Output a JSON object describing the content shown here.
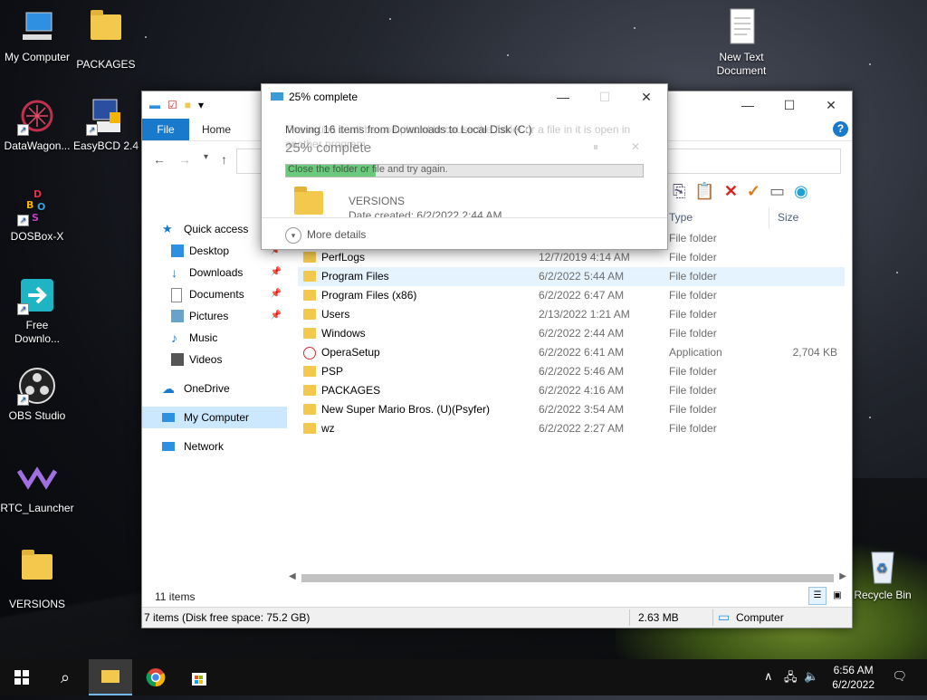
{
  "desktop": {
    "icons": [
      {
        "label": "My Computer"
      },
      {
        "label": "PACKAGES"
      },
      {
        "label": "DataWagon..."
      },
      {
        "label": "EasyBCD 2.4"
      },
      {
        "label": "DOSBox-X"
      },
      {
        "label": "Free Downlo..."
      },
      {
        "label": "OBS Studio"
      },
      {
        "label": "RTC_Launcher"
      },
      {
        "label": "VERSIONS"
      },
      {
        "label": "New Text Document"
      },
      {
        "label": "Recycle Bin"
      }
    ]
  },
  "explorer": {
    "ribbon_tabs": {
      "file": "File",
      "home": "Home"
    },
    "nav": {
      "quick_access": "Quick access",
      "desktop": "Desktop",
      "downloads": "Downloads",
      "documents": "Documents",
      "pictures": "Pictures",
      "music": "Music",
      "videos": "Videos",
      "onedrive": "OneDrive",
      "my_computer": "My Computer",
      "network": "Network"
    },
    "columns": {
      "type": "Type",
      "size": "Size"
    },
    "rows": [
      {
        "name": "",
        "date": "",
        "type": "File folder",
        "size": ""
      },
      {
        "name": "PerfLogs",
        "date": "12/7/2019 4:14 AM",
        "type": "File folder",
        "size": ""
      },
      {
        "name": "Program Files",
        "date": "6/2/2022 5:44 AM",
        "type": "File folder",
        "size": ""
      },
      {
        "name": "Program Files (x86)",
        "date": "6/2/2022 6:47 AM",
        "type": "File folder",
        "size": ""
      },
      {
        "name": "Users",
        "date": "2/13/2022 1:21 AM",
        "type": "File folder",
        "size": ""
      },
      {
        "name": "Windows",
        "date": "6/2/2022 2:44 AM",
        "type": "File folder",
        "size": ""
      },
      {
        "name": "OperaSetup",
        "date": "6/2/2022 6:41 AM",
        "type": "Application",
        "size": "2,704 KB"
      },
      {
        "name": "PSP",
        "date": "6/2/2022 5:46 AM",
        "type": "File folder",
        "size": ""
      },
      {
        "name": "PACKAGES",
        "date": "6/2/2022 4:16 AM",
        "type": "File folder",
        "size": ""
      },
      {
        "name": "New Super Mario Bros. (U)(Psyfer)",
        "date": "6/2/2022 3:54 AM",
        "type": "File folder",
        "size": ""
      },
      {
        "name": "wz",
        "date": "6/2/2022 2:27 AM",
        "type": "File folder",
        "size": ""
      }
    ],
    "item_count": "11 items",
    "status": {
      "left": "7 items (Disk free space: 75.2 GB)",
      "size": "2.63 MB",
      "location": "Computer"
    }
  },
  "dialog": {
    "title": "25% complete",
    "message": "Moving 16 items from Downloads to Local Disk (C:)",
    "ghost_message": "The action can't be completed because the folder or a file in it is open in another program",
    "big_status": "25% complete",
    "bar_text": "Close the folder or file and try again.",
    "progress": 0.25,
    "file_name": "VERSIONS",
    "file_date": "Date created: 6/2/2022 2:44 AM",
    "more_details": "More details"
  },
  "taskbar": {
    "time": "6:56 AM",
    "date": "6/2/2022"
  },
  "colors": {
    "accent": "#1979ca",
    "progress": "#06b025",
    "selection": "#cce8ff"
  }
}
